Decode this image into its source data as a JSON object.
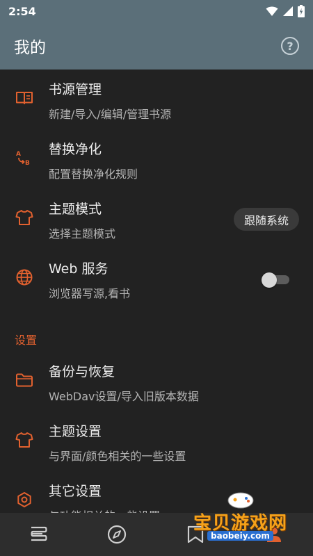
{
  "status_bar": {
    "time": "2:54"
  },
  "app_bar": {
    "title": "我的",
    "help_icon": "question-circle-icon"
  },
  "items": [
    {
      "title": "书源管理",
      "subtitle": "新建/导入/编辑/管理书源",
      "icon": "book-open-icon"
    },
    {
      "title": "替换净化",
      "subtitle": "配置替换净化规则",
      "icon": "replace-ab-icon"
    },
    {
      "title": "主题模式",
      "subtitle": "选择主题模式",
      "icon": "tshirt-icon",
      "chip": "跟随系统"
    },
    {
      "title": "Web 服务",
      "subtitle": "浏览器写源,看书",
      "icon": "globe-icon",
      "switch_on": false
    }
  ],
  "section_header": "设置",
  "settings": [
    {
      "title": "备份与恢复",
      "subtitle": "WebDav设置/导入旧版本数据",
      "icon": "folder-icon"
    },
    {
      "title": "主题设置",
      "subtitle": "与界面/颜色相关的一些设置",
      "icon": "tshirt-icon"
    },
    {
      "title": "其它设置",
      "subtitle": "与功能相关的一些设置",
      "icon": "gear-hex-icon"
    }
  ],
  "bottom_nav": [
    {
      "icon": "bookshelf-icon"
    },
    {
      "icon": "compass-icon"
    },
    {
      "icon": "rss-bookmark-icon"
    },
    {
      "icon": "person-icon"
    }
  ],
  "watermark": {
    "text": "宝贝游戏网",
    "url": "baobeiy.com"
  },
  "colors": {
    "accent": "#e2612f",
    "app_bar": "#5b6f79",
    "background": "#222222",
    "bottom_nav": "#2d2d2d"
  }
}
